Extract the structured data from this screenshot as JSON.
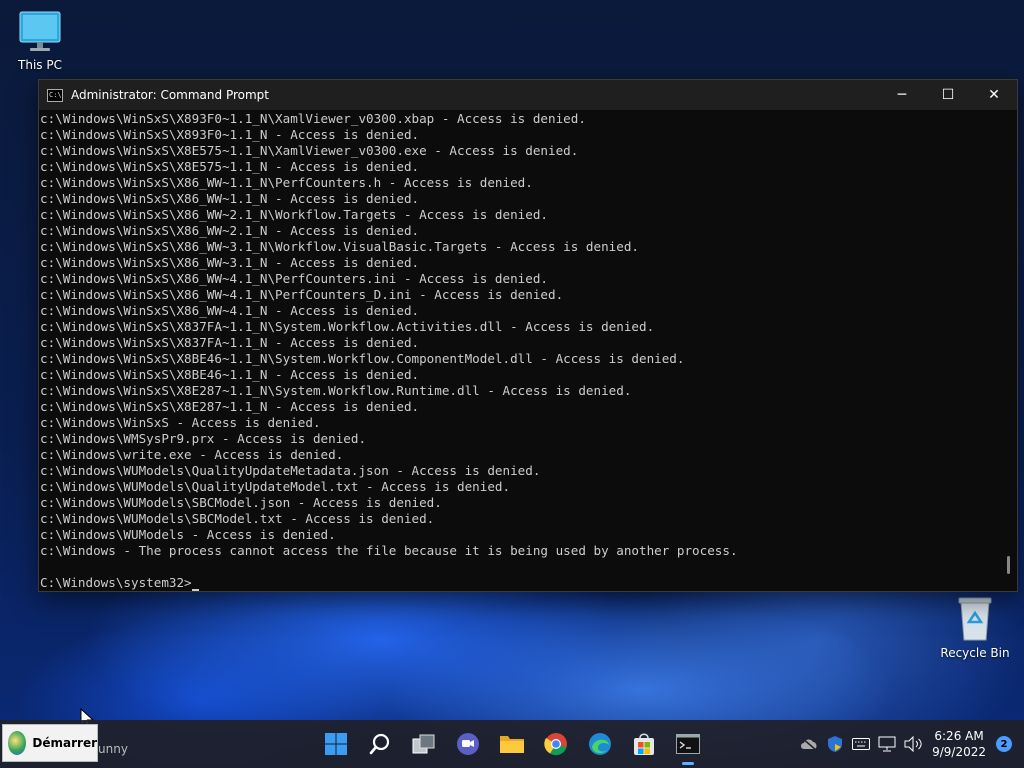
{
  "desktop": {
    "this_pc_label": "This PC",
    "recycle_bin_label": "Recycle Bin"
  },
  "window": {
    "title": "Administrator: Command Prompt",
    "icon_text": "C:\\",
    "minimize_glyph": "─",
    "maximize_glyph": "☐",
    "close_glyph": "✕"
  },
  "console": {
    "lines": [
      "c:\\Windows\\WinSxS\\X893F0~1.1_N\\XamlViewer_v0300.xbap - Access is denied.",
      "c:\\Windows\\WinSxS\\X893F0~1.1_N - Access is denied.",
      "c:\\Windows\\WinSxS\\X8E575~1.1_N\\XamlViewer_v0300.exe - Access is denied.",
      "c:\\Windows\\WinSxS\\X8E575~1.1_N - Access is denied.",
      "c:\\Windows\\WinSxS\\X86_WW~1.1_N\\PerfCounters.h - Access is denied.",
      "c:\\Windows\\WinSxS\\X86_WW~1.1_N - Access is denied.",
      "c:\\Windows\\WinSxS\\X86_WW~2.1_N\\Workflow.Targets - Access is denied.",
      "c:\\Windows\\WinSxS\\X86_WW~2.1_N - Access is denied.",
      "c:\\Windows\\WinSxS\\X86_WW~3.1_N\\Workflow.VisualBasic.Targets - Access is denied.",
      "c:\\Windows\\WinSxS\\X86_WW~3.1_N - Access is denied.",
      "c:\\Windows\\WinSxS\\X86_WW~4.1_N\\PerfCounters.ini - Access is denied.",
      "c:\\Windows\\WinSxS\\X86_WW~4.1_N\\PerfCounters_D.ini - Access is denied.",
      "c:\\Windows\\WinSxS\\X86_WW~4.1_N - Access is denied.",
      "c:\\Windows\\WinSxS\\X837FA~1.1_N\\System.Workflow.Activities.dll - Access is denied.",
      "c:\\Windows\\WinSxS\\X837FA~1.1_N - Access is denied.",
      "c:\\Windows\\WinSxS\\X8BE46~1.1_N\\System.Workflow.ComponentModel.dll - Access is denied.",
      "c:\\Windows\\WinSxS\\X8BE46~1.1_N - Access is denied.",
      "c:\\Windows\\WinSxS\\X8E287~1.1_N\\System.Workflow.Runtime.dll - Access is denied.",
      "c:\\Windows\\WinSxS\\X8E287~1.1_N - Access is denied.",
      "c:\\Windows\\WinSxS - Access is denied.",
      "c:\\Windows\\WMSysPr9.prx - Access is denied.",
      "c:\\Windows\\write.exe - Access is denied.",
      "c:\\Windows\\WUModels\\QualityUpdateMetadata.json - Access is denied.",
      "c:\\Windows\\WUModels\\QualityUpdateModel.txt - Access is denied.",
      "c:\\Windows\\WUModels\\SBCModel.json - Access is denied.",
      "c:\\Windows\\WUModels\\SBCModel.txt - Access is denied.",
      "c:\\Windows\\WUModels - Access is denied.",
      "c:\\Windows - The process cannot access the file because it is being used by another process.",
      ""
    ],
    "prompt": "C:\\Windows\\system32>"
  },
  "taskbar": {
    "start_label": "Démarrer",
    "behind_text": "unny",
    "apps": [
      {
        "name": "windows-start-icon"
      },
      {
        "name": "search-icon"
      },
      {
        "name": "task-view-icon"
      },
      {
        "name": "chat-icon"
      },
      {
        "name": "file-explorer-icon"
      },
      {
        "name": "chrome-icon"
      },
      {
        "name": "edge-icon"
      },
      {
        "name": "store-icon"
      },
      {
        "name": "command-prompt-icon"
      }
    ],
    "clock_time": "6:26 AM",
    "clock_date": "9/9/2022",
    "notification_count": "2"
  },
  "colors": {
    "console_bg": "#0c0c0c",
    "console_text": "#cccccc",
    "titlebar_bg": "#1f1f1f",
    "accent": "#4c9bff"
  }
}
